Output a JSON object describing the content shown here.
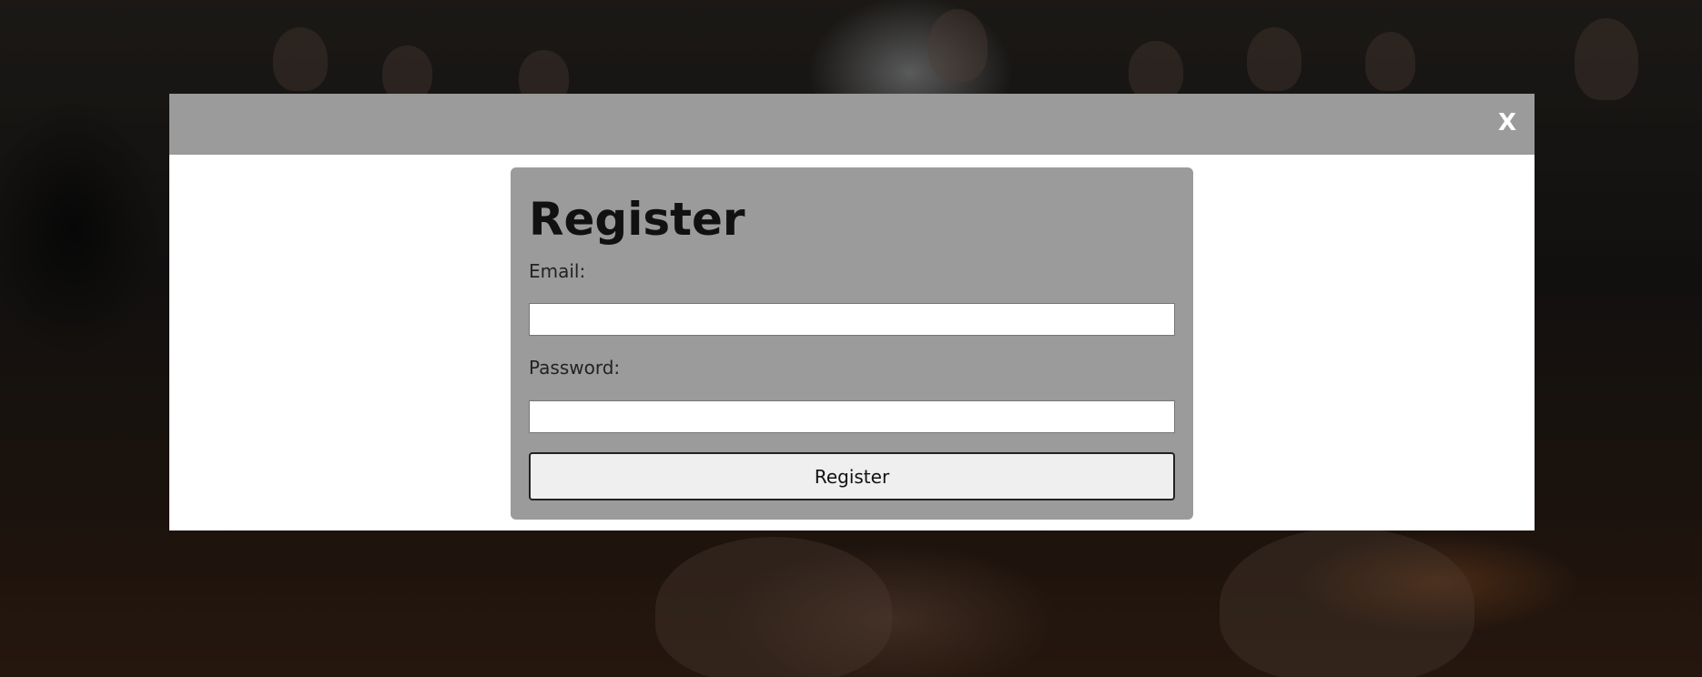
{
  "modal": {
    "close_label": "X",
    "header_color": "#9b9b9b"
  },
  "form": {
    "title": "Register",
    "email_label": "Email:",
    "email_value": "",
    "password_label": "Password:",
    "password_value": "",
    "submit_label": "Register"
  },
  "colors": {
    "card_background": "#9b9b9b",
    "modal_background": "#ffffff",
    "button_background": "#efefef"
  }
}
